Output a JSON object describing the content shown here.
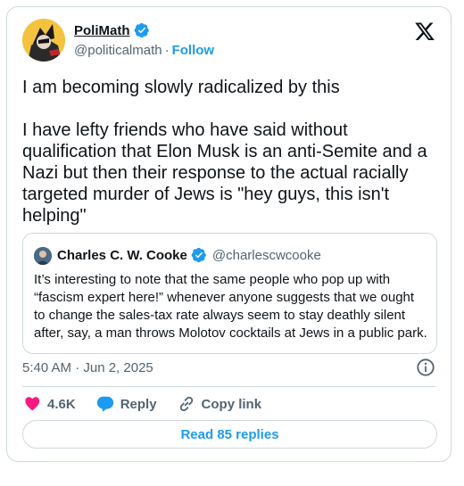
{
  "author": {
    "name": "PoliMath",
    "handle": "@politicalmath",
    "separator": "·",
    "follow_label": "Follow"
  },
  "tweet": {
    "text": "I am becoming slowly radicalized by this\n\nI have lefty friends who have said without qualification that Elon Musk is an anti-Semite and a Nazi but then their response to the actual racially targeted murder of Jews is \"hey guys, this isn't helping\"",
    "timestamp": "5:40 AM · Jun 2, 2025"
  },
  "quote": {
    "name": "Charles C. W. Cooke",
    "handle": "@charlescwcooke",
    "text": "It’s interesting to note that the same people who pop up with “fascism expert here!” whenever anyone suggests that we ought to change the sales-tax rate always seem to stay deathly silent after, say, a man throws Molotov cocktails at Jews in a public park."
  },
  "actions": {
    "likes": "4.6K",
    "reply_label": "Reply",
    "copy_link_label": "Copy link"
  },
  "read_replies_label": "Read 85 replies",
  "colors": {
    "accent": "#1d9bf0",
    "like": "#f91880",
    "text": "#0f1419",
    "muted": "#536471",
    "border": "#cfd9de"
  },
  "icons": [
    "avatar",
    "verified-badge-icon",
    "x-logo-icon",
    "info-icon",
    "heart-icon",
    "reply-bubble-icon",
    "link-icon"
  ]
}
